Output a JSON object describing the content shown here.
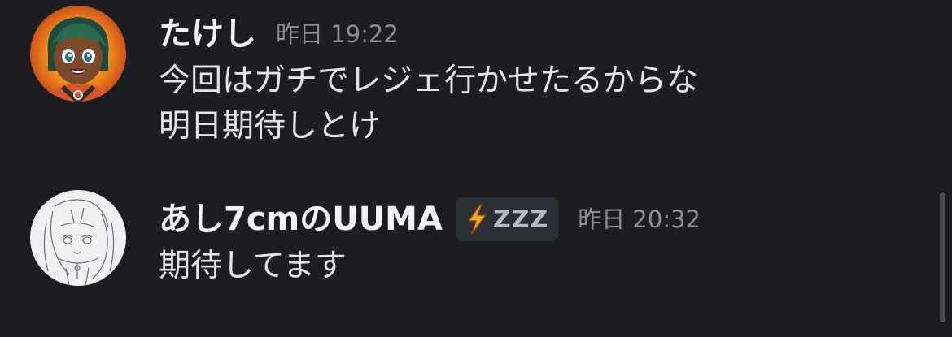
{
  "messages": [
    {
      "username": "たけし",
      "timestamp": "昨日 19:22",
      "lines": [
        "今回はガチでレジェ行かせたるからな",
        "明日期待しとけ"
      ],
      "avatar_icon": "avatar-anime-character"
    },
    {
      "username": "あし7cmのUUMA",
      "status": {
        "icon": "lightning-bolt-icon",
        "text": "ZZZ"
      },
      "timestamp": "昨日 20:32",
      "lines": [
        "期待してます"
      ],
      "avatar_icon": "avatar-line-sketch"
    }
  ],
  "colors": {
    "background": "#1c1d21",
    "username": "#f2f3f5",
    "timestamp": "#8c8e94",
    "message_text": "#e3e5e8",
    "badge_background": "#2d2f36",
    "bolt": "#f5a524"
  }
}
